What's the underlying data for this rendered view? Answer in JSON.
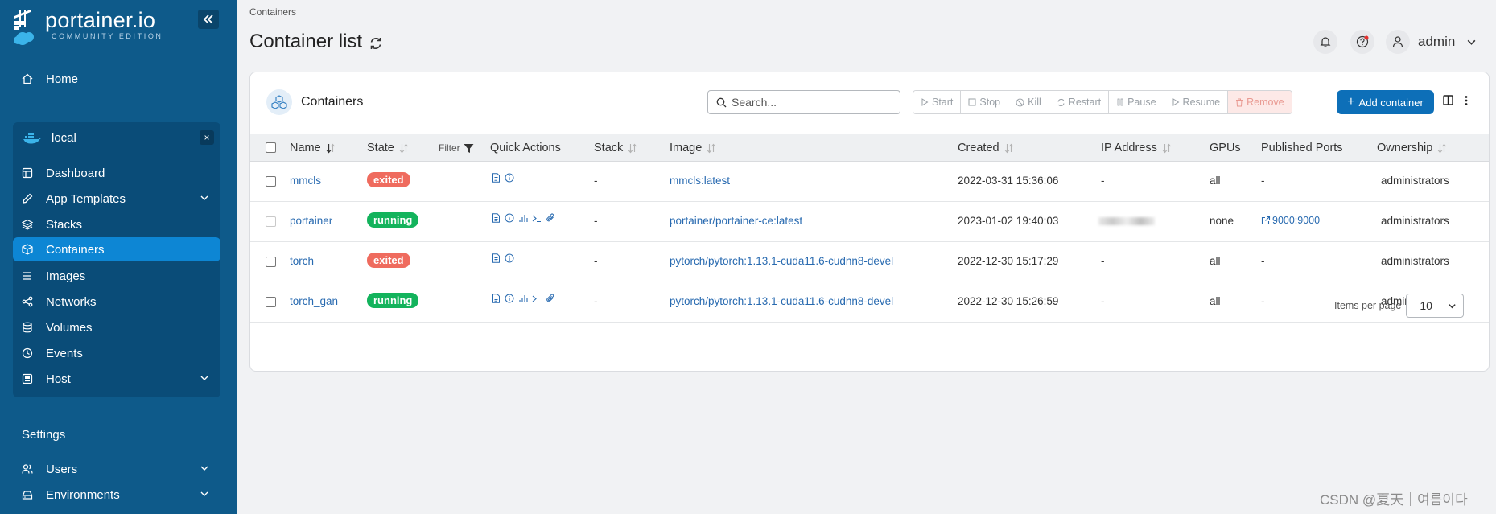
{
  "brand": {
    "name": "portainer.io",
    "edition": "COMMUNITY EDITION"
  },
  "sidebar": {
    "home": "Home",
    "environment": "local",
    "env_close": "×",
    "items": [
      {
        "label": "Dashboard",
        "icon": "dashboard-icon"
      },
      {
        "label": "App Templates",
        "icon": "edit-icon",
        "expandable": true
      },
      {
        "label": "Stacks",
        "icon": "layers-icon"
      },
      {
        "label": "Containers",
        "icon": "box-icon",
        "active": true
      },
      {
        "label": "Images",
        "icon": "list-icon"
      },
      {
        "label": "Networks",
        "icon": "share-icon"
      },
      {
        "label": "Volumes",
        "icon": "database-icon"
      },
      {
        "label": "Events",
        "icon": "clock-icon"
      },
      {
        "label": "Host",
        "icon": "server-icon",
        "expandable": true
      }
    ],
    "settings_title": "Settings",
    "settings_items": [
      {
        "label": "Users",
        "icon": "users-icon",
        "expandable": true
      },
      {
        "label": "Environments",
        "icon": "hdd-icon",
        "expandable": true
      }
    ]
  },
  "header": {
    "breadcrumb": "Containers",
    "title": "Container list",
    "user": "admin"
  },
  "card": {
    "title": "Containers",
    "search_placeholder": "Search...",
    "actions": [
      "Start",
      "Stop",
      "Kill",
      "Restart",
      "Pause",
      "Resume",
      "Remove"
    ],
    "add_button": "Add container"
  },
  "table": {
    "columns": {
      "name": "Name",
      "state": "State",
      "filter": "Filter",
      "quick_actions": "Quick Actions",
      "stack": "Stack",
      "image": "Image",
      "created": "Created",
      "ip": "IP Address",
      "gpus": "GPUs",
      "ports": "Published Ports",
      "ownership": "Ownership"
    },
    "rows": [
      {
        "name": "mmcls",
        "state": "exited",
        "stack": "-",
        "image": "mmcls:latest",
        "created": "2022-03-31 15:36:06",
        "ip": "-",
        "gpus": "all",
        "ports": "-",
        "ownership": "administrators"
      },
      {
        "name": "portainer",
        "state": "running",
        "stack": "-",
        "image": "portainer/portainer-ce:latest",
        "created": "2023-01-02 19:40:03",
        "ip": "",
        "gpus": "none",
        "ports": "9000:9000",
        "ownership": "administrators"
      },
      {
        "name": "torch",
        "state": "exited",
        "stack": "-",
        "image": "pytorch/pytorch:1.13.1-cuda11.6-cudnn8-devel",
        "created": "2022-12-30 15:17:29",
        "ip": "-",
        "gpus": "all",
        "ports": "-",
        "ownership": "administrators"
      },
      {
        "name": "torch_gan",
        "state": "running",
        "stack": "-",
        "image": "pytorch/pytorch:1.13.1-cuda11.6-cudnn8-devel",
        "created": "2022-12-30 15:26:59",
        "ip": "-",
        "gpus": "all",
        "ports": "-",
        "ownership": "administrators"
      }
    ]
  },
  "pagination": {
    "items_per_page_label": "Items per page",
    "items_per_page": "10"
  },
  "watermark": "CSDN @夏天｜여름이다",
  "colors": {
    "sidebar": "#0e5a8a",
    "accent": "#0d6fb8",
    "running": "#13b35c",
    "exited": "#ef6b5e",
    "link": "#286ab0"
  }
}
